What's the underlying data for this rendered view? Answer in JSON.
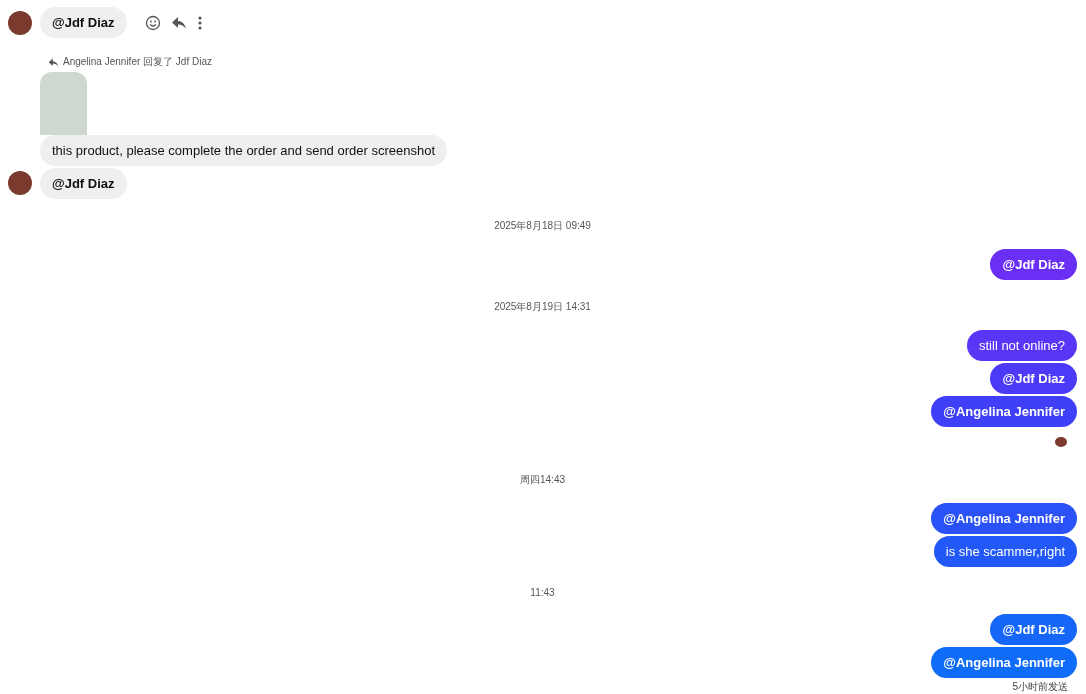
{
  "messages": [
    {
      "kind": "incoming",
      "text": "@Jdf Diaz",
      "mention": true,
      "avatar": true,
      "hovered": true
    },
    {
      "kind": "reply-note",
      "text": "Angelina Jennifer 回复了 Jdf Diaz"
    },
    {
      "kind": "image"
    },
    {
      "kind": "incoming",
      "text": "this product, please complete the order and send order screenshot",
      "mention": false,
      "avatar": false,
      "hovered": false
    },
    {
      "kind": "incoming",
      "text": "@Jdf Diaz",
      "mention": true,
      "avatar": true,
      "hovered": false
    },
    {
      "kind": "time",
      "text": "2025年8月18日 09:49"
    },
    {
      "kind": "outgoing",
      "text": "@Jdf Diaz",
      "mention": true,
      "color": "#6a2ff5"
    },
    {
      "kind": "time",
      "text": "2025年8月19日 14:31"
    },
    {
      "kind": "outgoing",
      "text": "still not online?",
      "mention": false,
      "color": "#5936f5"
    },
    {
      "kind": "outgoing",
      "text": "@Jdf Diaz",
      "mention": true,
      "color": "#4c3af6"
    },
    {
      "kind": "outgoing",
      "text": "@Angelina Jennifer",
      "mention": true,
      "color": "#3e3ff7"
    },
    {
      "kind": "seen"
    },
    {
      "kind": "time",
      "text": "周四14:43"
    },
    {
      "kind": "outgoing",
      "text": "@Angelina Jennifer",
      "mention": true,
      "color": "#2a52f6"
    },
    {
      "kind": "outgoing",
      "text": "is she scammer,right",
      "mention": false,
      "color": "#2158f7"
    },
    {
      "kind": "time",
      "text": "11:43"
    },
    {
      "kind": "outgoing",
      "text": "@Jdf Diaz",
      "mention": true,
      "color": "#1666f8"
    },
    {
      "kind": "outgoing",
      "text": "@Angelina Jennifer",
      "mention": true,
      "color": "#0f6cf8"
    },
    {
      "kind": "status",
      "text": "5小时前发送"
    }
  ]
}
